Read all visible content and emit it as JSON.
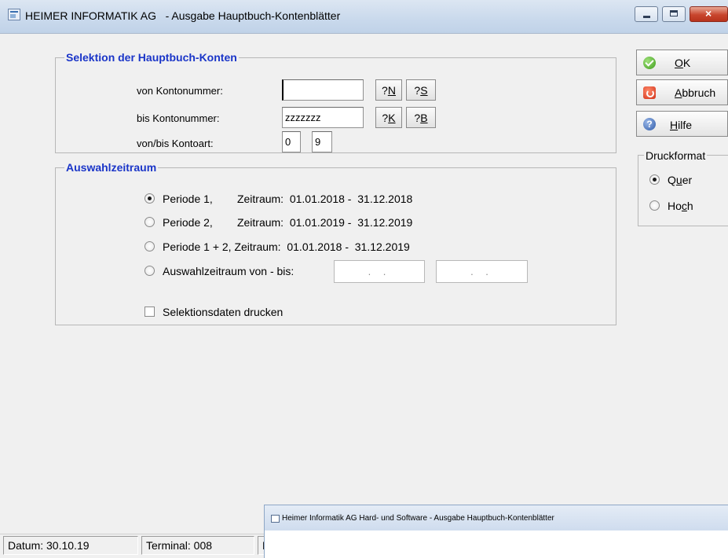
{
  "window": {
    "title": "HEIMER INFORMATIK AG   - Ausgabe Hauptbuch-Kontenblätter"
  },
  "selektion": {
    "title": "Selektion der Hauptbuch-Konten",
    "von_label": "von Kontonummer:",
    "von_value": "",
    "bis_label": "bis Kontonummer:",
    "bis_value": "zzzzzzz",
    "art_label": "von/bis Kontoart:",
    "art_von": "0",
    "art_bis": "9",
    "btn_n": {
      "prefix": "?",
      "key": "N"
    },
    "btn_s": {
      "prefix": "?",
      "key": "S"
    },
    "btn_k": {
      "prefix": "?",
      "key": "K"
    },
    "btn_b": {
      "prefix": "?",
      "key": "B"
    }
  },
  "zeitraum": {
    "title": "Auswahlzeitraum",
    "options": [
      {
        "label": "Periode 1,        Zeitraum:  01.01.2018 -  31.12.2018",
        "selected": true
      },
      {
        "label": "Periode 2,        Zeitraum:  01.01.2019 -  31.12.2019",
        "selected": false
      },
      {
        "label": "Periode 1 + 2, Zeitraum:  01.01.2018 -  31.12.2019",
        "selected": false
      },
      {
        "label": "Auswahlzeitraum von - bis:",
        "selected": false
      }
    ],
    "date_from_placeholder": " . .",
    "date_to_placeholder": " . .",
    "checkbox_label": "Selektionsdaten drucken",
    "checkbox_checked": false
  },
  "buttons": {
    "ok": {
      "accel": "O",
      "rest": "K"
    },
    "abbruch": {
      "accel": "A",
      "rest": "bbruch"
    },
    "hilfe": {
      "accel": "H",
      "rest": "ilfe"
    }
  },
  "druckformat": {
    "title": "Druckformat",
    "quer": {
      "pre": "Q",
      "accel": "u",
      "post": "er",
      "selected": true
    },
    "hoch": {
      "pre": "Ho",
      "accel": "c",
      "post": "h",
      "selected": false
    }
  },
  "status": {
    "datum": "Datum: 30.10.19",
    "terminal": "Terminal: 008",
    "partial": "B"
  },
  "sub_window": {
    "title": "Heimer Informatik AG Hard- und Software - Ausgabe Hauptbuch-Kontenblätter"
  }
}
